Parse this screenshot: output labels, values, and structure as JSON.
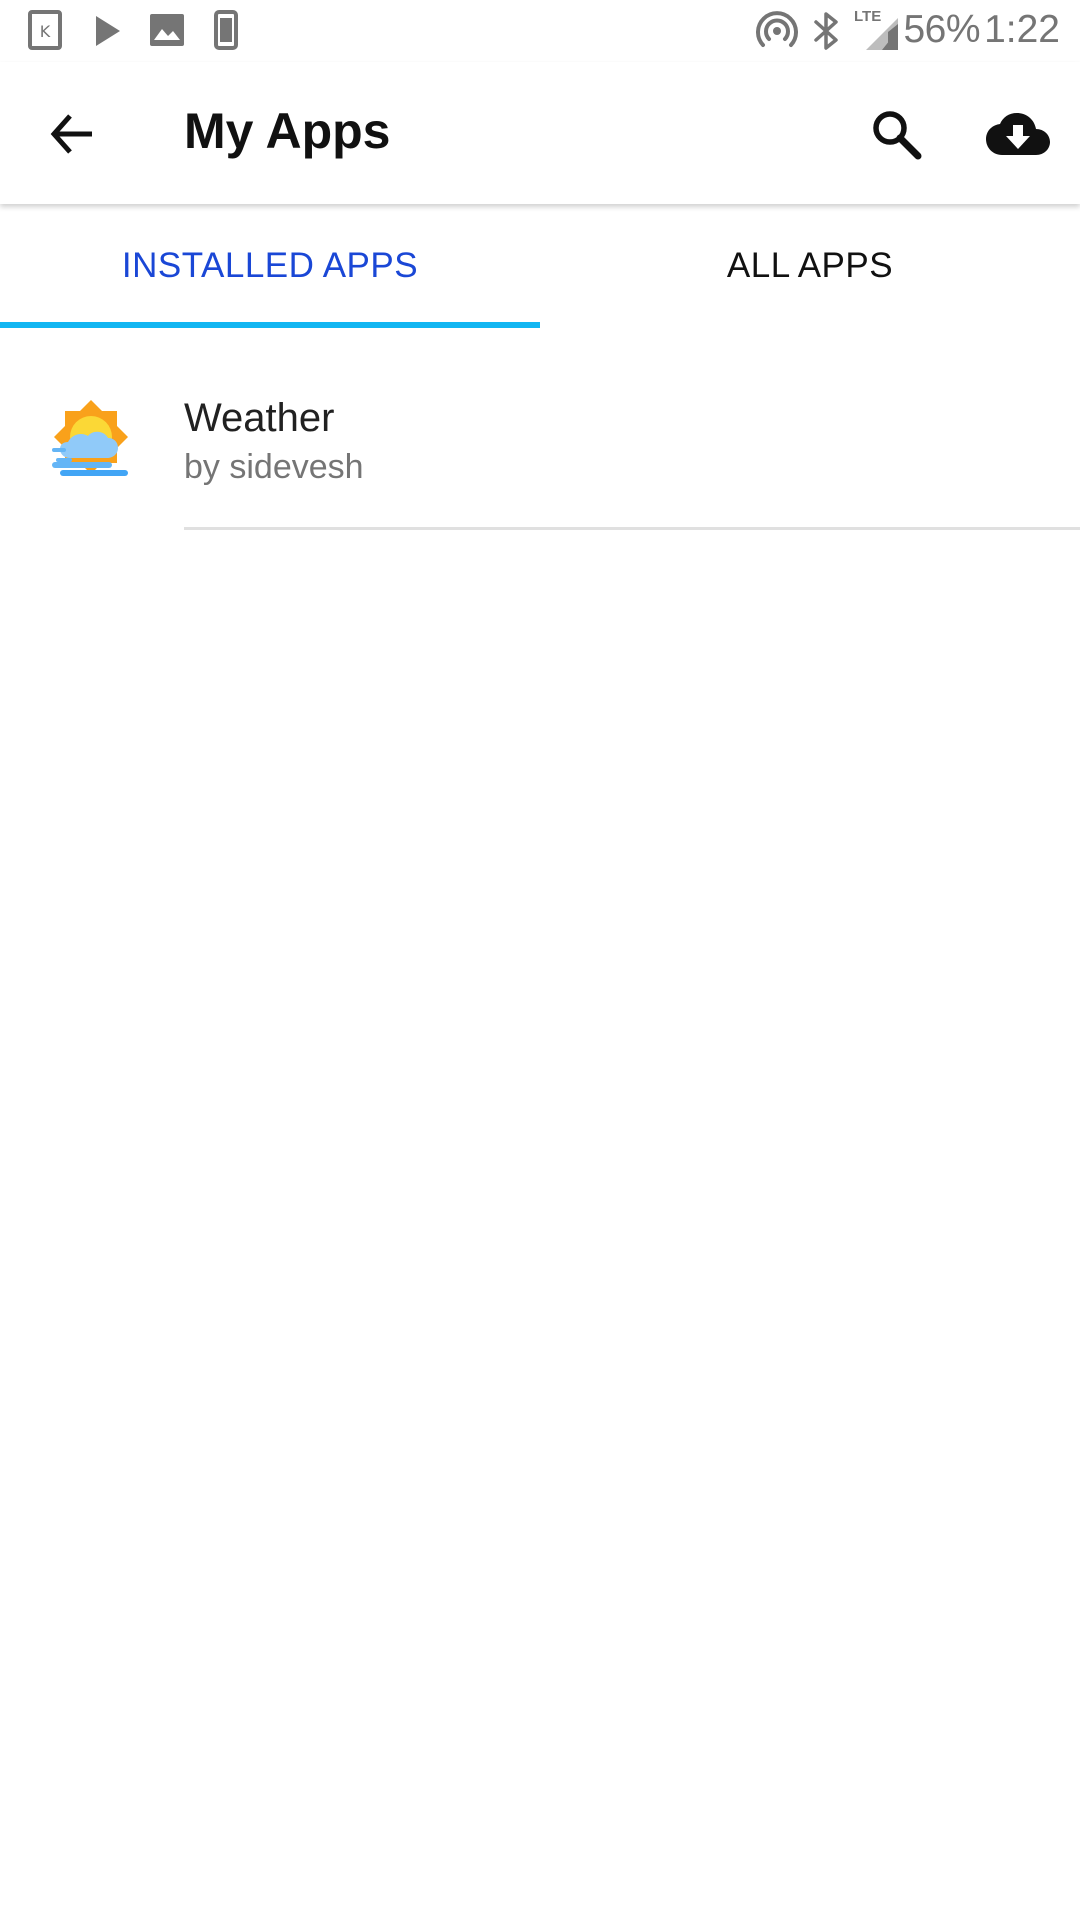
{
  "status_bar": {
    "battery_percent": "56%",
    "time": "1:22",
    "network_type": "LTE",
    "icons": [
      "kindle-icon",
      "play-store-icon",
      "image-icon",
      "device-icon",
      "hotspot-icon",
      "bluetooth-icon",
      "lte-signal-icon"
    ]
  },
  "app_bar": {
    "title": "My Apps",
    "back_icon": "arrow-back-icon",
    "search_icon": "search-icon",
    "download_icon": "cloud-download-icon"
  },
  "tabs": [
    {
      "label": "INSTALLED APPS",
      "selected": true
    },
    {
      "label": "ALL APPS",
      "selected": false
    }
  ],
  "apps": [
    {
      "name": "Weather",
      "author": "by sidevesh",
      "icon": "weather-sun-cloud-icon"
    }
  ],
  "colors": {
    "tab_selected_text": "#1a47d6",
    "tab_indicator": "#12b6f2",
    "title_text": "#111111",
    "secondary_text": "#757575"
  }
}
